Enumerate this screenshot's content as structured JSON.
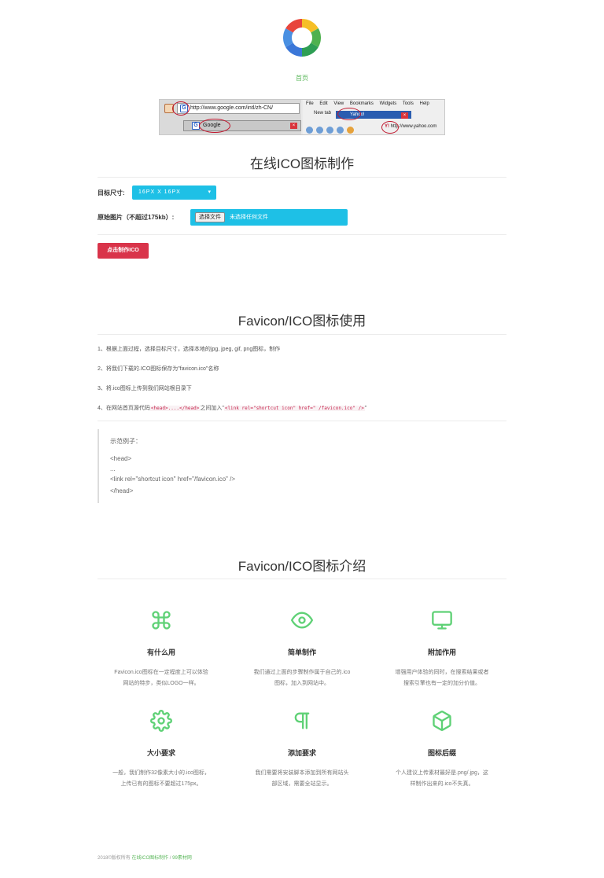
{
  "nav": {
    "home": "首页"
  },
  "demo": {
    "address": "http://www.google.com/intl/zh-CN/",
    "tab_title": "Google",
    "menu": "File Edit View Bookmarks Widgets Tools Help",
    "new_tab": "New tab",
    "yahoo_tab": "Yahoo!",
    "yahoo_url": "http://www.yahoo.com"
  },
  "tool": {
    "title": "在线ICO图标制作",
    "size_label": "目标尺寸:",
    "size_value": "16PX X 16PX",
    "image_label": "原始图片（不超过175kb）:",
    "file_button": "选择文件",
    "file_status": "未选择任何文件",
    "make_button": "点击制作ICO"
  },
  "usage": {
    "title": "Favicon/ICO图标使用",
    "steps": [
      "1、根据上面过程，选择目标尺寸，选择本地的jpg, jpeg, gif, png图标，制作",
      "2、将我们下载的.ICO图标保存为\"favicon.ico\"名称",
      "3、将.ico图标上传到我们网站根目录下"
    ],
    "step4_prefix": "4、在网站首页源代码",
    "step4_code1": "<head>....</head>",
    "step4_mid": "之间加入\"",
    "step4_code2": "<link rel=\"shortcut icon\" href=\" /favicon.ico\" />",
    "step4_suffix": "\"",
    "example_title": "示范例子：",
    "example_lines": [
      "<head>",
      "...",
      "<link rel=\"shortcut icon\" href=\"/favicon.ico\" />",
      "</head>"
    ]
  },
  "intro": {
    "title": "Favicon/ICO图标介绍",
    "accent": "#5fd176",
    "features": [
      {
        "icon": "command-icon",
        "title": "有什么用",
        "desc": [
          "Favicon.ico图标在一定程度上可以体验",
          "网站的特步，类似LOGO一样。"
        ]
      },
      {
        "icon": "eye-icon",
        "title": "简单制作",
        "desc": [
          "我们通过上面的步骤制作属于自己的.ico",
          "图标，加入到网站中。"
        ]
      },
      {
        "icon": "monitor-icon",
        "title": "附加作用",
        "desc": [
          "增强用户体验的同时，在搜索结果或者",
          "搜索引擎也有一定的加分价值。"
        ]
      },
      {
        "icon": "gear-icon",
        "title": "大小要求",
        "desc": [
          "一般，我们制作32像素大小的.ico图标，",
          "上传已有的图标不要超过175px。"
        ]
      },
      {
        "icon": "pilcrow-icon",
        "title": "添加要求",
        "desc": [
          "我们需要将安装脚本添加到所有网站头",
          "部区域，需要全站显示。"
        ]
      },
      {
        "icon": "cube-icon",
        "title": "图标后缀",
        "desc": [
          "个人建议上传素材最好是.png/.jpg，这",
          "样制作出来的.ico不失真。"
        ]
      }
    ]
  },
  "footer": {
    "copyright": "2018©版权所有",
    "link": "在线ICO图标制作",
    "sep": "/",
    "source": "99素材网"
  }
}
